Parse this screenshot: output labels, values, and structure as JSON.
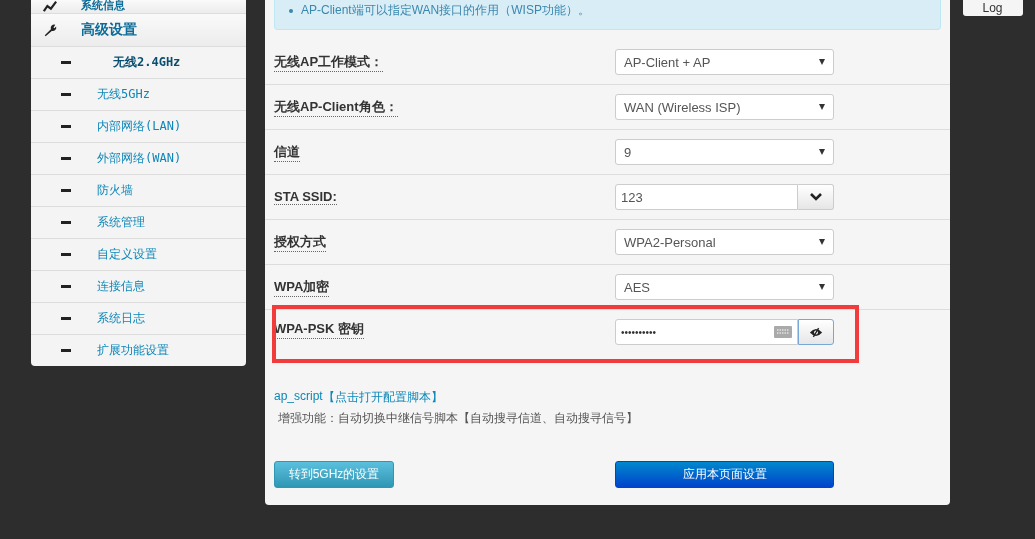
{
  "top_button": {
    "label": "Log"
  },
  "sidebar": {
    "sections": [
      {
        "label": "系统信息"
      },
      {
        "label": "高级设置",
        "children": [
          {
            "label": "无线2.4GHz",
            "selected": true
          },
          {
            "label": "无线5GHz",
            "selected": false
          },
          {
            "label": "内部网络(LAN)",
            "selected": false
          },
          {
            "label": "外部网络(WAN)",
            "selected": false
          },
          {
            "label": "防火墙",
            "selected": false
          },
          {
            "label": "系统管理",
            "selected": false
          },
          {
            "label": "自定义设置",
            "selected": false
          },
          {
            "label": "连接信息",
            "selected": false
          },
          {
            "label": "系统日志",
            "selected": false
          },
          {
            "label": "扩展功能设置",
            "selected": false
          }
        ]
      }
    ]
  },
  "info_box": {
    "items": [
      "AP-Client端可以指定WAN接口的作用（WISP功能）。"
    ]
  },
  "form": {
    "rows": [
      {
        "label": "无线AP工作模式：",
        "kind": "select",
        "value": "AP-Client + AP"
      },
      {
        "label": "无线AP-Client角色：",
        "kind": "select",
        "value": "WAN (Wireless ISP)"
      },
      {
        "label": "信道",
        "kind": "select",
        "value": "9"
      },
      {
        "label": "STA SSID:",
        "kind": "combo",
        "value": "123"
      },
      {
        "label": "授权方式",
        "kind": "select",
        "value": "WPA2-Personal"
      },
      {
        "label": "WPA加密",
        "kind": "select",
        "value": "AES"
      },
      {
        "label": "WPA-PSK 密钥",
        "kind": "password",
        "value": "••••••••••",
        "highlighted": true
      }
    ]
  },
  "script_link": {
    "name": "ap_script",
    "link": "【点击打开配置脚本】",
    "description": "增强功能：自动切换中继信号脚本【自动搜寻信道、自动搜寻信号】"
  },
  "buttons": [
    {
      "label": "转到5GHz的设置",
      "kind": "secondary"
    },
    {
      "label": "应用本页面设置",
      "kind": "primary"
    }
  ]
}
